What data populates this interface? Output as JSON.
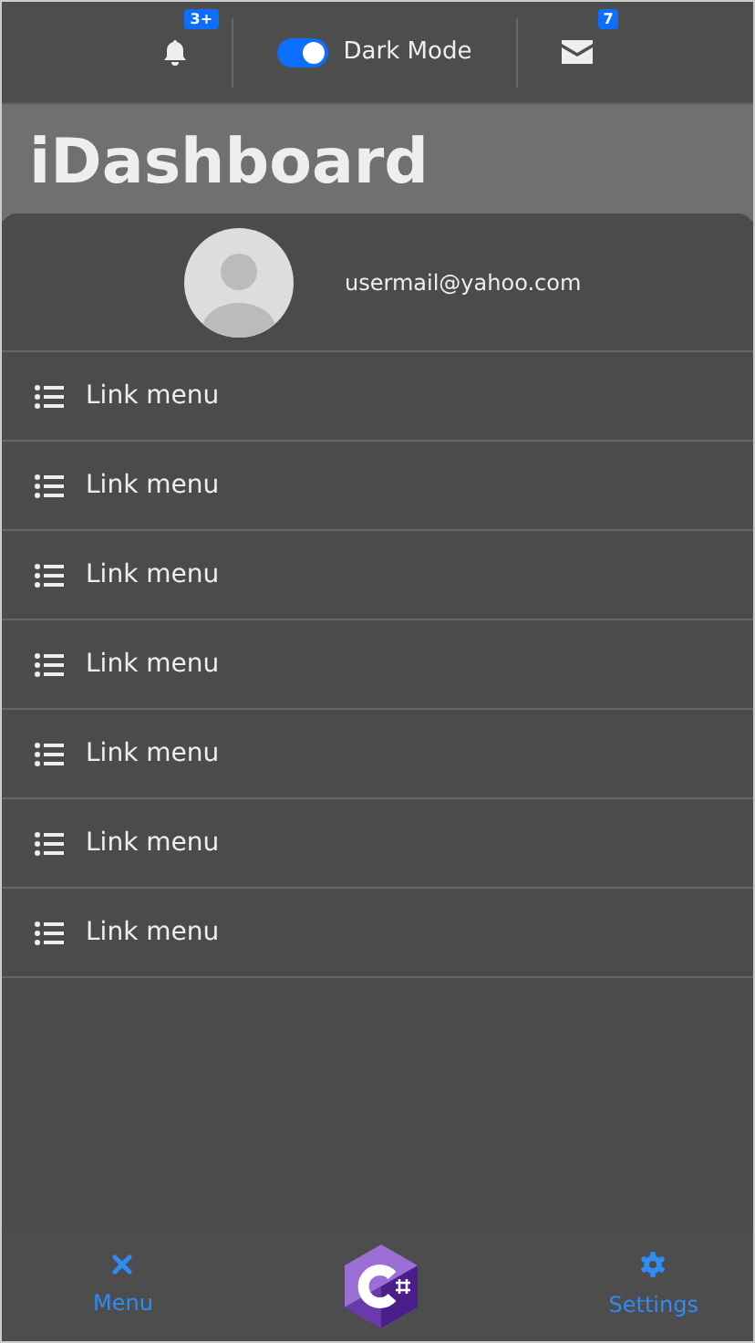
{
  "top_bar": {
    "notifications_badge": "3+",
    "dark_mode": {
      "label": "Dark Mode",
      "on": true
    },
    "messages_badge": "7"
  },
  "header": {
    "title": "iDashboard"
  },
  "profile": {
    "email": "usermail@yahoo.com"
  },
  "menu": [
    {
      "label": "Link menu"
    },
    {
      "label": "Link menu"
    },
    {
      "label": "Link menu"
    },
    {
      "label": "Link menu"
    },
    {
      "label": "Link menu"
    },
    {
      "label": "Link menu"
    },
    {
      "label": "Link menu"
    }
  ],
  "bottom_nav": {
    "left": {
      "label": "Menu"
    },
    "right": {
      "label": "Settings"
    }
  }
}
